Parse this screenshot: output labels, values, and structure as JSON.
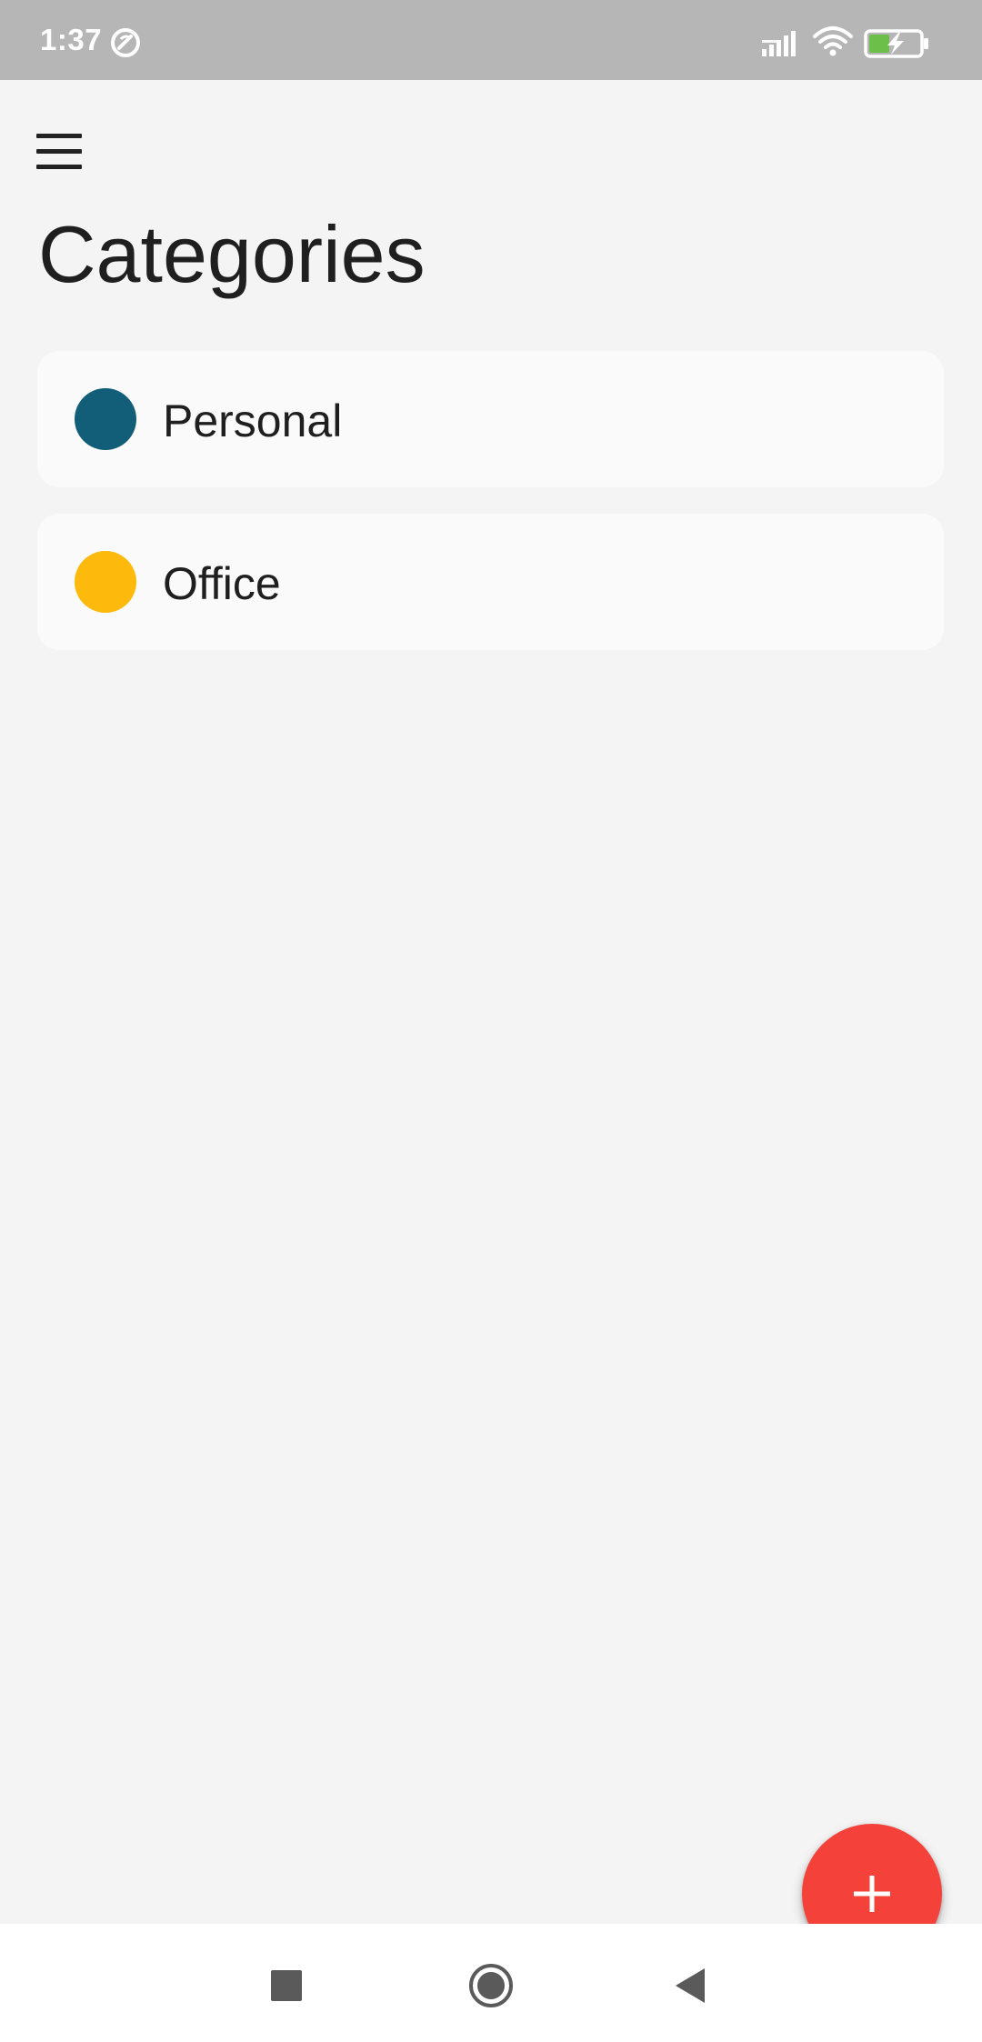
{
  "status_bar": {
    "time": "1:37",
    "dnd_icon": "do-not-disturb-icon",
    "signal_icon": "signal-icon",
    "wifi_icon": "wifi-icon",
    "battery_icon": "battery-charging-icon",
    "background_color": "#b6b6b6"
  },
  "toolbar": {
    "menu_icon": "hamburger-menu-icon"
  },
  "page": {
    "title": "Categories",
    "background_color": "#f4f4f4"
  },
  "categories": [
    {
      "label": "Personal",
      "color": "#125d78"
    },
    {
      "label": "Office",
      "color": "#fdba0c"
    }
  ],
  "fab": {
    "icon": "plus-icon",
    "color": "#f4423a"
  },
  "nav_bar": {
    "recents_icon": "square-recents-icon",
    "home_icon": "circle-home-icon",
    "back_icon": "triangle-back-icon"
  }
}
